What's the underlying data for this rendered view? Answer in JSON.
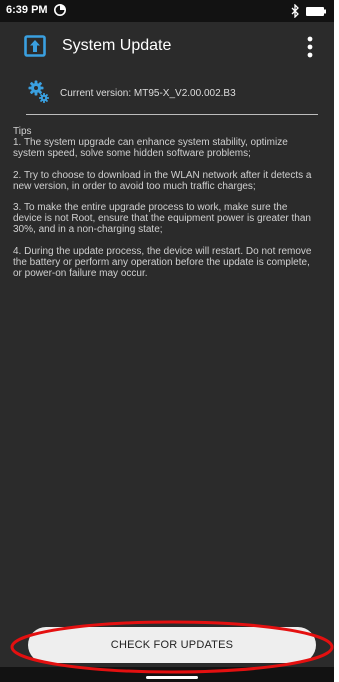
{
  "status_bar": {
    "time": "6:39 PM"
  },
  "app_bar": {
    "title": "System Update",
    "overflow_icon": "more-vert-icon"
  },
  "version": {
    "text": "Current version: MT95-X_V2.00.002.B3",
    "icon": "gear-icon"
  },
  "tips": {
    "title": "Tips",
    "items": [
      "1. The system upgrade can enhance system stability, optimize system speed, solve some hidden software problems;",
      "2. Try to choose to download in the WLAN network after it detects a new version, in order to avoid too much traffic charges;",
      "3. To make the entire upgrade process to work, make sure the device is not Root, ensure that the equipment power is greater than 30%, and in a non-charging state;",
      "4. During the update process, the device will restart. Do not remove the battery or perform any operation before the update is complete, or power-on failure may occur."
    ]
  },
  "actions": {
    "check_label": "CHECK FOR UPDATES"
  },
  "colors": {
    "background": "#2b2b2b",
    "status_bar": "#121212",
    "accent": "#3aa0e0",
    "highlight": "#e41010",
    "button": "#eeeeee"
  }
}
